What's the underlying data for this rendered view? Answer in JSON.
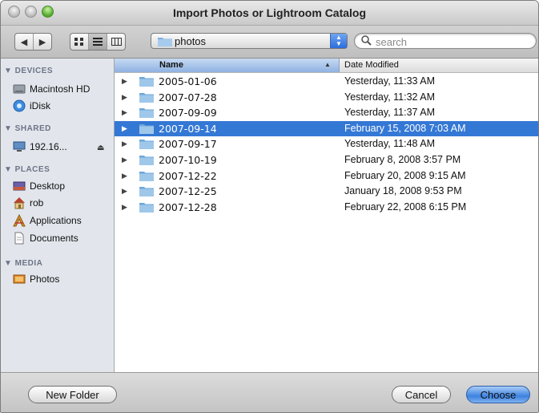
{
  "window": {
    "title": "Import Photos or Lightroom Catalog"
  },
  "toolbar": {
    "location": "photos",
    "search_placeholder": "search"
  },
  "sidebar": {
    "sections": {
      "devices": "▼ DEVICES",
      "shared": "▼ SHARED",
      "places": "▼ PLACES",
      "media": "▼ MEDIA"
    },
    "devices": [
      "Macintosh HD",
      "iDisk"
    ],
    "shared": [
      "192.16..."
    ],
    "places": [
      "Desktop",
      "rob",
      "Applications",
      "Documents"
    ],
    "media": [
      "Photos"
    ]
  },
  "list": {
    "columns": {
      "name": "Name",
      "date": "Date Modified"
    },
    "rows": [
      {
        "name": "2005-01-06",
        "date": "Yesterday, 11:33 AM",
        "selected": false
      },
      {
        "name": "2007-07-28",
        "date": "Yesterday, 11:32 AM",
        "selected": false
      },
      {
        "name": "2007-09-09",
        "date": "Yesterday, 11:37 AM",
        "selected": false
      },
      {
        "name": "2007-09-14",
        "date": "February 15, 2008 7:03 AM",
        "selected": true
      },
      {
        "name": "2007-09-17",
        "date": "Yesterday, 11:48 AM",
        "selected": false
      },
      {
        "name": "2007-10-19",
        "date": "February 8, 2008 3:57 PM",
        "selected": false
      },
      {
        "name": "2007-12-22",
        "date": "February 20, 2008 9:15 AM",
        "selected": false
      },
      {
        "name": "2007-12-25",
        "date": "January 18, 2008 9:53 PM",
        "selected": false
      },
      {
        "name": "2007-12-28",
        "date": "February 22, 2008 6:15 PM",
        "selected": false
      }
    ]
  },
  "buttons": {
    "new_folder": "New Folder",
    "cancel": "Cancel",
    "choose": "Choose"
  },
  "colors": {
    "selection": "#3478d5",
    "sidebar_bg": "#e2e6ec",
    "default_button": "#3e82e0"
  },
  "icons": {
    "nav_back": "back-arrow-icon",
    "nav_forward": "forward-arrow-icon",
    "view_icon": "icon-view-icon",
    "view_list": "list-view-icon",
    "view_column": "column-view-icon",
    "search": "search-icon",
    "folder": "folder-icon",
    "eject": "eject-icon"
  }
}
